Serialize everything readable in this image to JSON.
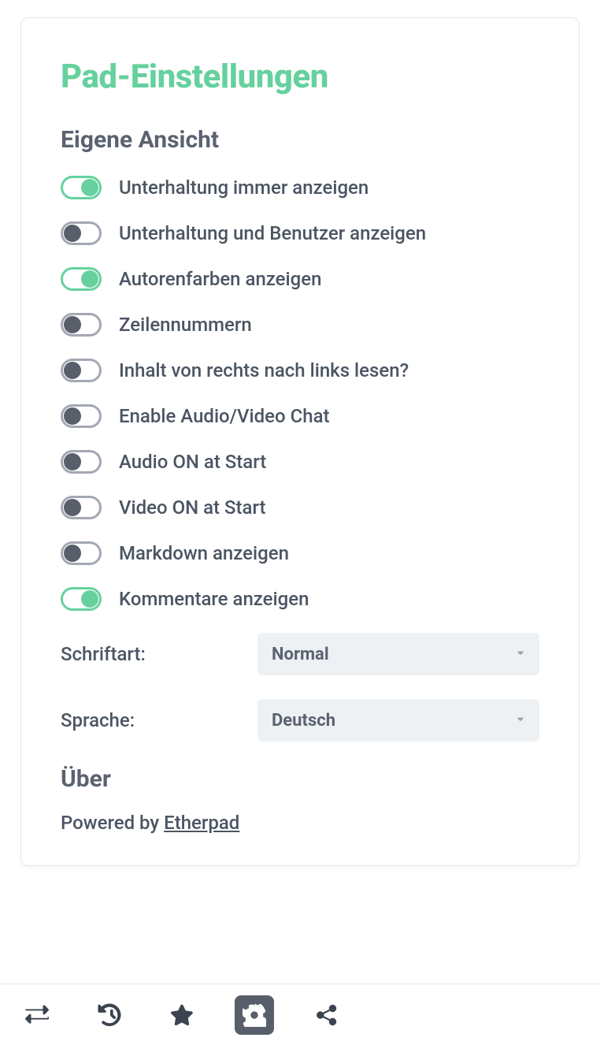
{
  "title": "Pad-Einstellungen",
  "section_view": "Eigene Ansicht",
  "toggles": [
    {
      "label": "Unterhaltung immer anzeigen",
      "on": true
    },
    {
      "label": "Unterhaltung und Benutzer anzeigen",
      "on": false
    },
    {
      "label": "Autorenfarben anzeigen",
      "on": true
    },
    {
      "label": "Zeilennummern",
      "on": false
    },
    {
      "label": "Inhalt von rechts nach links lesen?",
      "on": false
    },
    {
      "label": "Enable Audio/Video Chat",
      "on": false
    },
    {
      "label": "Audio ON at Start",
      "on": false
    },
    {
      "label": "Video ON at Start",
      "on": false
    },
    {
      "label": "Markdown anzeigen",
      "on": false
    },
    {
      "label": "Kommentare anzeigen",
      "on": true
    }
  ],
  "font_label": "Schriftart:",
  "font_value": "Normal",
  "lang_label": "Sprache:",
  "lang_value": "Deutsch",
  "section_about": "Über",
  "powered_prefix": "Powered by ",
  "powered_link": "Etherpad",
  "toolbar": {
    "exchange": "exchange-icon",
    "history": "history-icon",
    "star": "star-icon",
    "settings": "gear-icon",
    "share": "share-icon"
  }
}
